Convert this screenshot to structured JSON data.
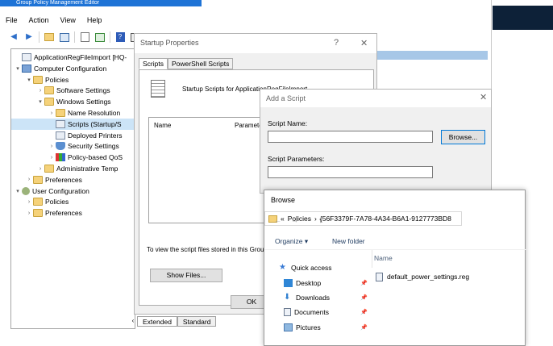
{
  "gpme": {
    "title": "Group Policy Management Editor",
    "menu": [
      "File",
      "Action",
      "View",
      "Help"
    ],
    "tree": [
      {
        "label": "ApplicationRegFileImport [HQ-",
        "level": 0,
        "icon": "doc",
        "twisty": ""
      },
      {
        "label": "Computer Configuration",
        "level": 0,
        "icon": "computer",
        "twisty": "▾"
      },
      {
        "label": "Policies",
        "level": 1,
        "icon": "folder",
        "twisty": "▾"
      },
      {
        "label": "Software Settings",
        "level": 2,
        "icon": "folder",
        "twisty": "›"
      },
      {
        "label": "Windows Settings",
        "level": 2,
        "icon": "folder",
        "twisty": "▾"
      },
      {
        "label": "Name Resolution",
        "level": 3,
        "icon": "folder",
        "twisty": "›"
      },
      {
        "label": "Scripts (Startup/S",
        "level": 3,
        "icon": "doc",
        "twisty": "",
        "selected": true
      },
      {
        "label": "Deployed Printers",
        "level": 3,
        "icon": "doc",
        "twisty": ""
      },
      {
        "label": "Security Settings",
        "level": 3,
        "icon": "shield",
        "twisty": "›"
      },
      {
        "label": "Policy-based QoS",
        "level": 3,
        "icon": "chart",
        "twisty": "›"
      },
      {
        "label": "Administrative Temp",
        "level": 2,
        "icon": "folder",
        "twisty": "›"
      },
      {
        "label": "Preferences",
        "level": 1,
        "icon": "folder",
        "twisty": "›"
      },
      {
        "label": "User Configuration",
        "level": 0,
        "icon": "user",
        "twisty": "▾"
      },
      {
        "label": "Policies",
        "level": 1,
        "icon": "folder",
        "twisty": "›"
      },
      {
        "label": "Preferences",
        "level": 1,
        "icon": "folder",
        "twisty": "›"
      }
    ],
    "tabs": [
      "Extended",
      "Standard"
    ]
  },
  "startup": {
    "title": "Startup Properties",
    "help": "?",
    "close": "✕",
    "tabs": [
      "Scripts",
      "PowerShell Scripts"
    ],
    "heading": "Startup Scripts for ApplicationRegFileImport",
    "columns": [
      "Name",
      "Paramete"
    ],
    "info": "To view the script files stored in this Grou the button below.",
    "show_files": "Show Files...",
    "ok": "OK"
  },
  "add_script": {
    "title": "Add a Script",
    "close": "✕",
    "name_label": "Script Name:",
    "name_value": "",
    "browse": "Browse...",
    "params_label": "Script Parameters:",
    "params_value": ""
  },
  "browse": {
    "title": "Browse",
    "nav": {
      "back": "←",
      "forward": "→",
      "down": "⌄",
      "up": "↑"
    },
    "path_prefix": "«",
    "path": [
      "Policies",
      "{56F3379F-7A78-4A34-B6A1-9127773BD8"
    ],
    "path_sep": "›",
    "organize": "Organize ▾",
    "new_folder": "New folder",
    "column_name": "Name",
    "quick_access": [
      {
        "label": "Quick access",
        "icon": "star"
      },
      {
        "label": "Desktop",
        "icon": "desktop"
      },
      {
        "label": "Downloads",
        "icon": "downloads"
      },
      {
        "label": "Documents",
        "icon": "documents"
      },
      {
        "label": "Pictures",
        "icon": "pictures"
      }
    ],
    "files": [
      "default_power_settings.reg"
    ]
  },
  "colors": {
    "title_blue": "#1e73d6",
    "selection": "#cce4f7",
    "dark_strip": "#0d2138"
  }
}
